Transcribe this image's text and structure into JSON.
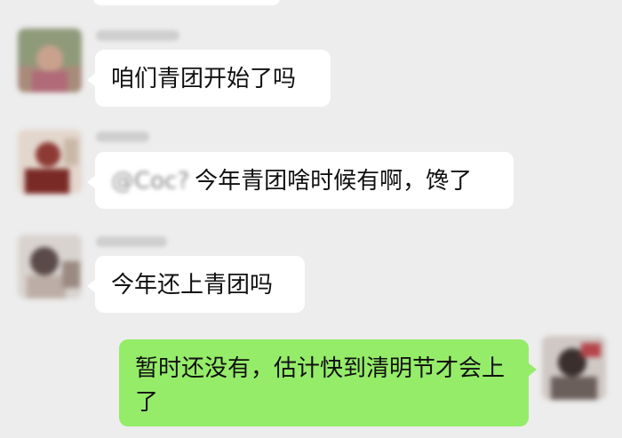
{
  "messages": [
    {
      "text": "咱们青团开始了吗"
    },
    {
      "mention": "@Coc?",
      "text": "今年青团啥时候有啊，馋了"
    },
    {
      "text": "今年还上青团吗"
    },
    {
      "text": "暂时还没有，估计快到清明节才会上了"
    }
  ],
  "colors": {
    "background": "#ededed",
    "incoming_bubble": "#ffffff",
    "outgoing_bubble": "#95ec69"
  }
}
